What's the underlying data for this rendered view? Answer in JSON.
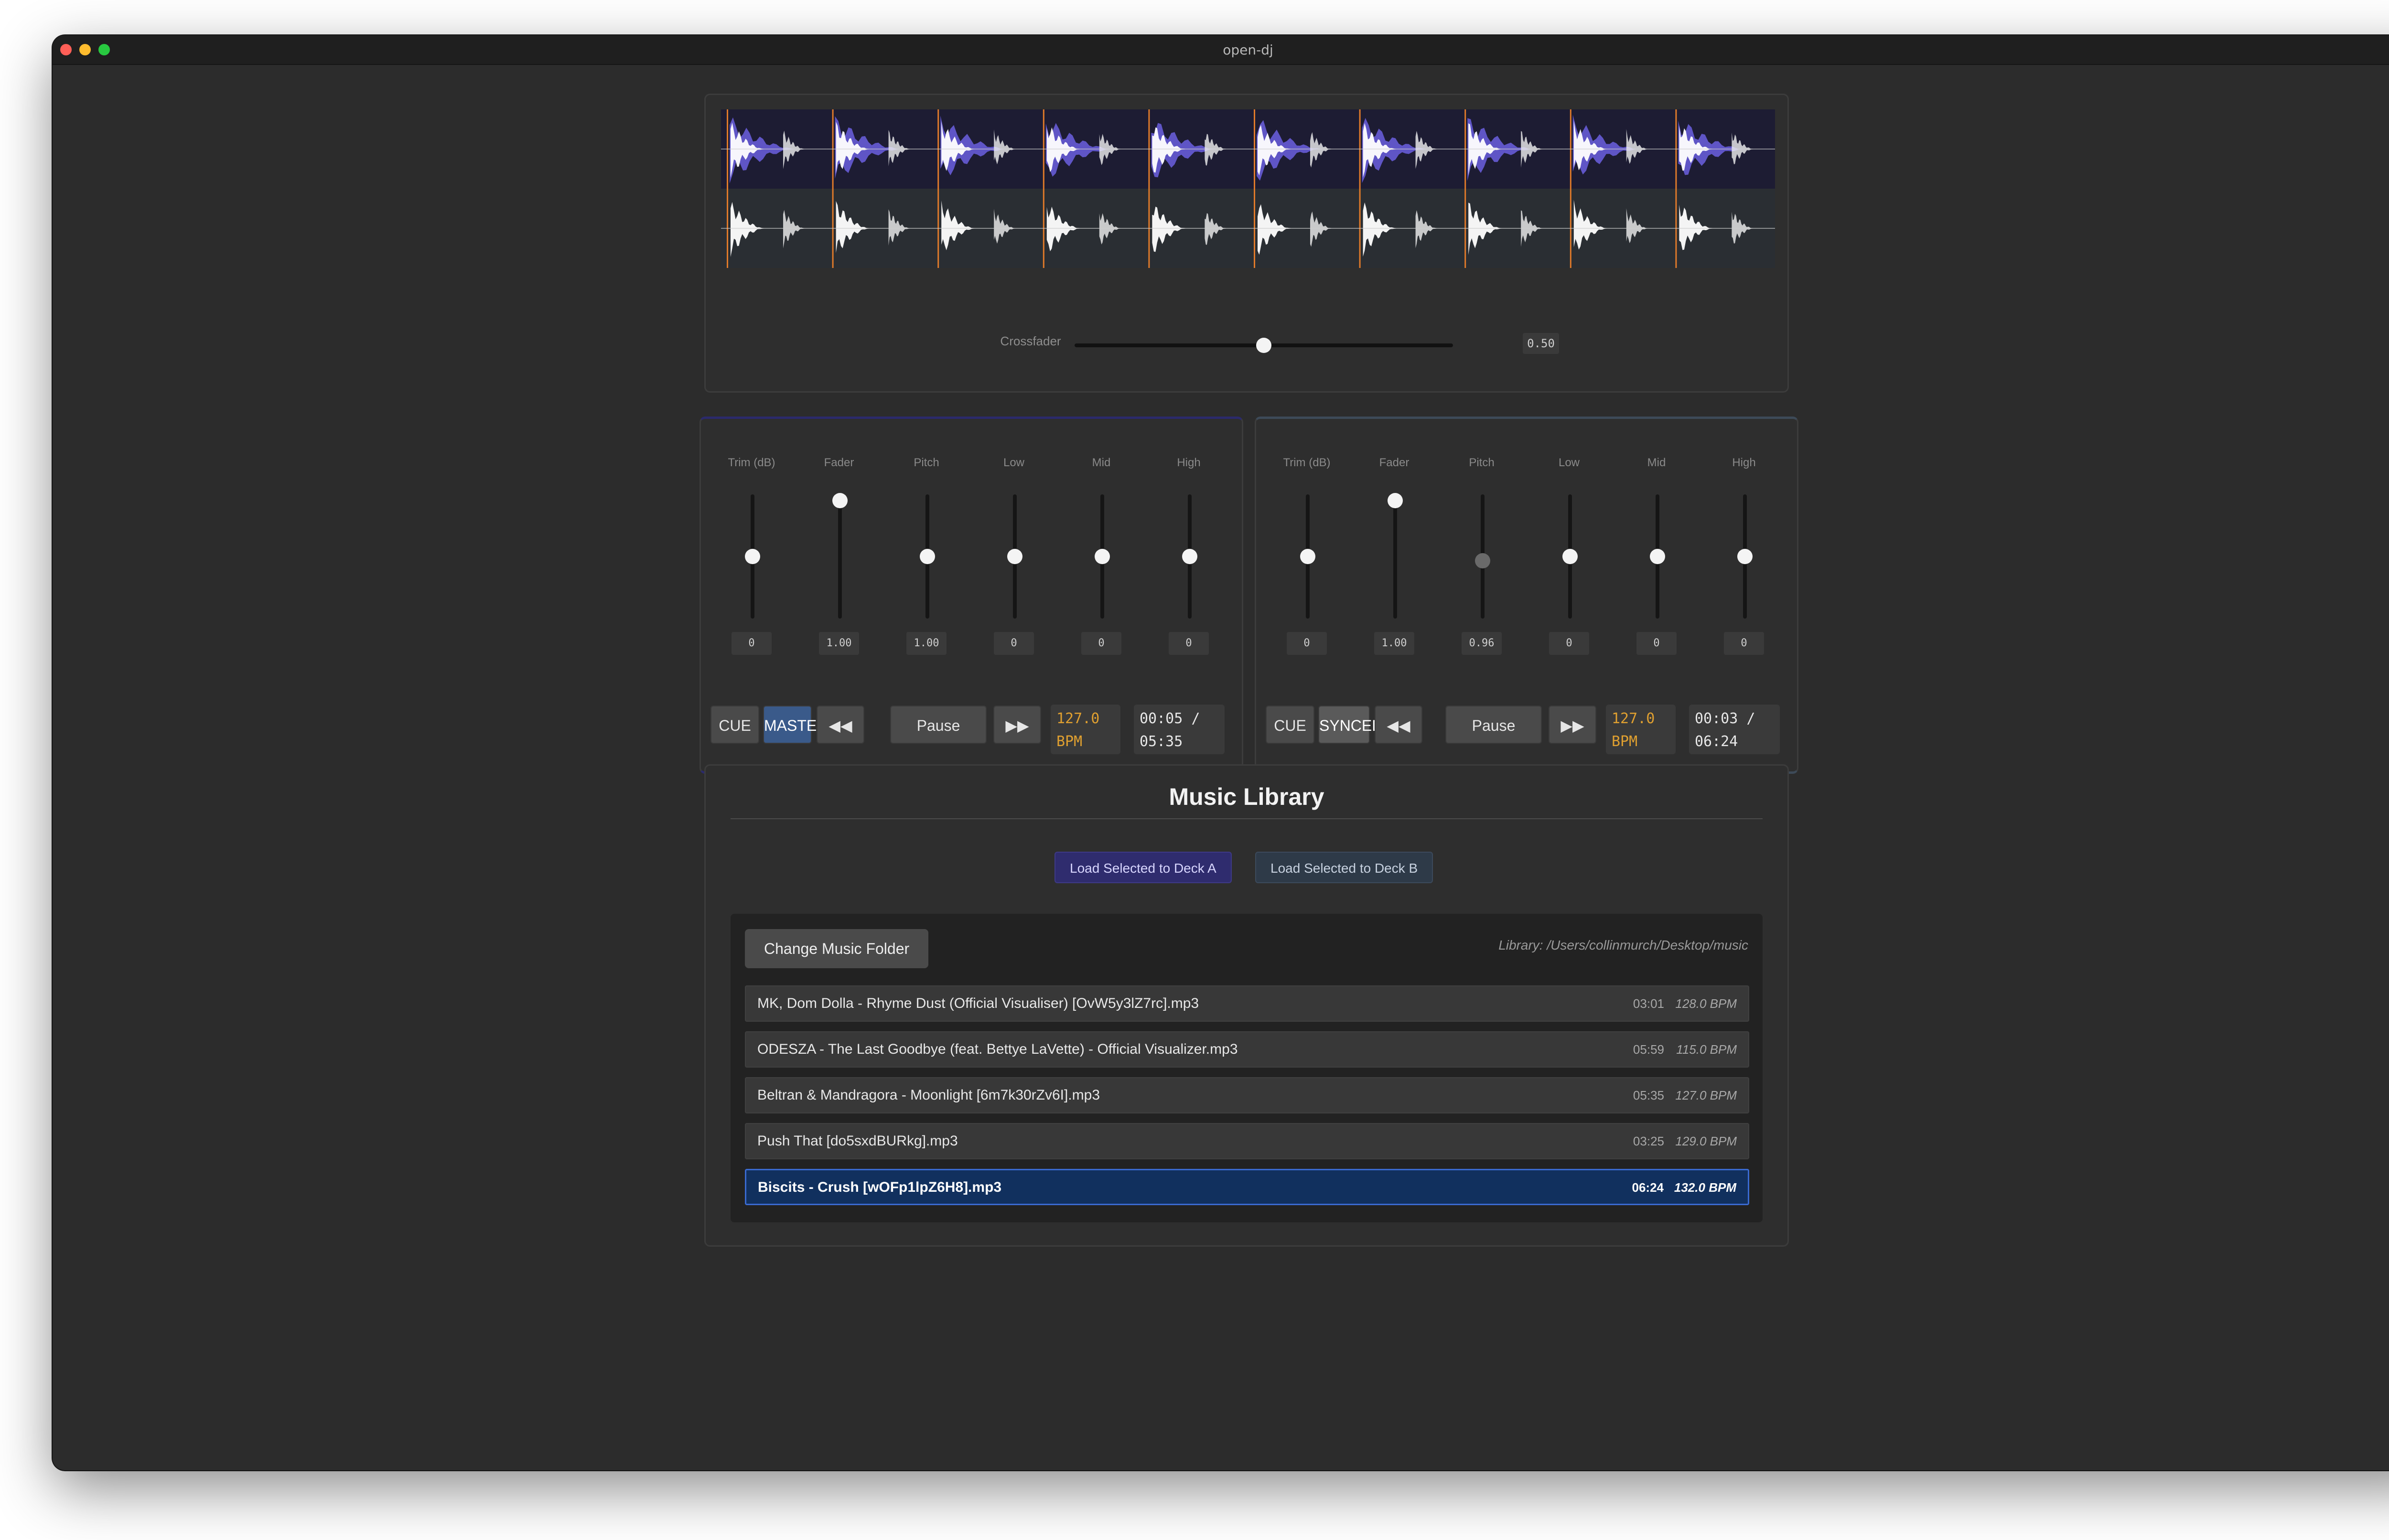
{
  "window": {
    "title": "open-dj"
  },
  "crossfader": {
    "label": "Crossfader",
    "value": "0.50",
    "level": 0.5
  },
  "deck_a": {
    "controls": [
      {
        "label": "Trim (dB)",
        "value": "0",
        "level": 0.5
      },
      {
        "label": "Fader",
        "value": "1.00",
        "level": 1.0
      },
      {
        "label": "Pitch",
        "value": "1.00",
        "level": 0.5
      },
      {
        "label": "Low",
        "value": "0",
        "level": 0.5
      },
      {
        "label": "Mid",
        "value": "0",
        "level": 0.5
      },
      {
        "label": "High",
        "value": "0",
        "level": 0.5
      }
    ],
    "cue_label": "CUE",
    "mode_label": "MASTER",
    "rewind_label": "◀◀",
    "play_label": "Pause",
    "forward_label": "▶▶",
    "bpm_value": "127.0",
    "bpm_unit": "BPM",
    "time_elapsed": "00:05 /",
    "time_total": "05:35"
  },
  "deck_b": {
    "controls": [
      {
        "label": "Trim (dB)",
        "value": "0",
        "level": 0.5
      },
      {
        "label": "Fader",
        "value": "1.00",
        "level": 1.0
      },
      {
        "label": "Pitch",
        "value": "0.96",
        "level": 0.46
      },
      {
        "label": "Low",
        "value": "0",
        "level": 0.5
      },
      {
        "label": "Mid",
        "value": "0",
        "level": 0.5
      },
      {
        "label": "High",
        "value": "0",
        "level": 0.5
      }
    ],
    "cue_label": "CUE",
    "mode_label": "SYNCED",
    "rewind_label": "◀◀",
    "play_label": "Pause",
    "forward_label": "▶▶",
    "bpm_value": "127.0",
    "bpm_unit": "BPM",
    "time_elapsed": "00:03 /",
    "time_total": "06:24"
  },
  "library": {
    "title": "Music Library",
    "load_a_label": "Load Selected to Deck A",
    "load_b_label": "Load Selected to Deck B",
    "change_folder_label": "Change Music Folder",
    "path": "Library: /Users/collinmurch/Desktop/music",
    "tracks": [
      {
        "name": "MK, Dom Dolla - Rhyme Dust (Official Visualiser) [OvW5y3lZ7rc].mp3",
        "duration": "03:01",
        "bpm": "128.0 BPM",
        "selected": false
      },
      {
        "name": "ODESZA - The Last Goodbye (feat. Bettye LaVette) - Official Visualizer.mp3",
        "duration": "05:59",
        "bpm": "115.0 BPM",
        "selected": false
      },
      {
        "name": "Beltran & Mandragora - Moonlight [6m7k30rZv6I].mp3",
        "duration": "05:35",
        "bpm": "127.0 BPM",
        "selected": false
      },
      {
        "name": "Push That [do5sxdBURkg].mp3",
        "duration": "03:25",
        "bpm": "129.0 BPM",
        "selected": false
      },
      {
        "name": "Biscits - Crush [wOFp1lpZ6H8].mp3",
        "duration": "06:24",
        "bpm": "132.0 BPM",
        "selected": true
      }
    ]
  },
  "colors": {
    "deck_a_wave_bg": "#1d1c33",
    "deck_a_wave_fill": "#6b5fe0",
    "deck_b_wave_bg": "#2a2e33",
    "beat_marker": "#e07a2a",
    "bpm_text": "#e0a030",
    "selected_row": "#11305e",
    "master_button": "#3a5a8a"
  }
}
